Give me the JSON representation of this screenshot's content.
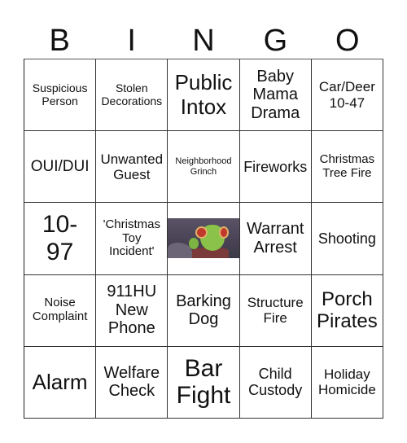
{
  "header": {
    "letters": [
      "B",
      "I",
      "N",
      "G",
      "O"
    ]
  },
  "cells": [
    [
      "Suspicious\nPerson",
      "Stolen\nDecorations",
      "Public\nIntox",
      "Baby\nMama\nDrama",
      "Car/Deer\n10-47"
    ],
    [
      "OUI/DUI",
      "Unwanted\nGuest",
      "Neighborhood\nGrinch",
      "Fireworks",
      "Christmas\nTree Fire"
    ],
    [
      "10-\n97",
      "'Christmas\nToy\nIncident'",
      "",
      "Warrant\nArrest",
      "Shooting"
    ],
    [
      "Noise\nComplaint",
      "911HU\nNew\nPhone",
      "Barking\nDog",
      "Structure\nFire",
      "Porch\nPirates"
    ],
    [
      "Alarm",
      "Welfare\nCheck",
      "Bar\nFight",
      "Child\nCustody",
      "Holiday\nHomicide"
    ]
  ],
  "free_space": {
    "image": "grinch-image"
  }
}
